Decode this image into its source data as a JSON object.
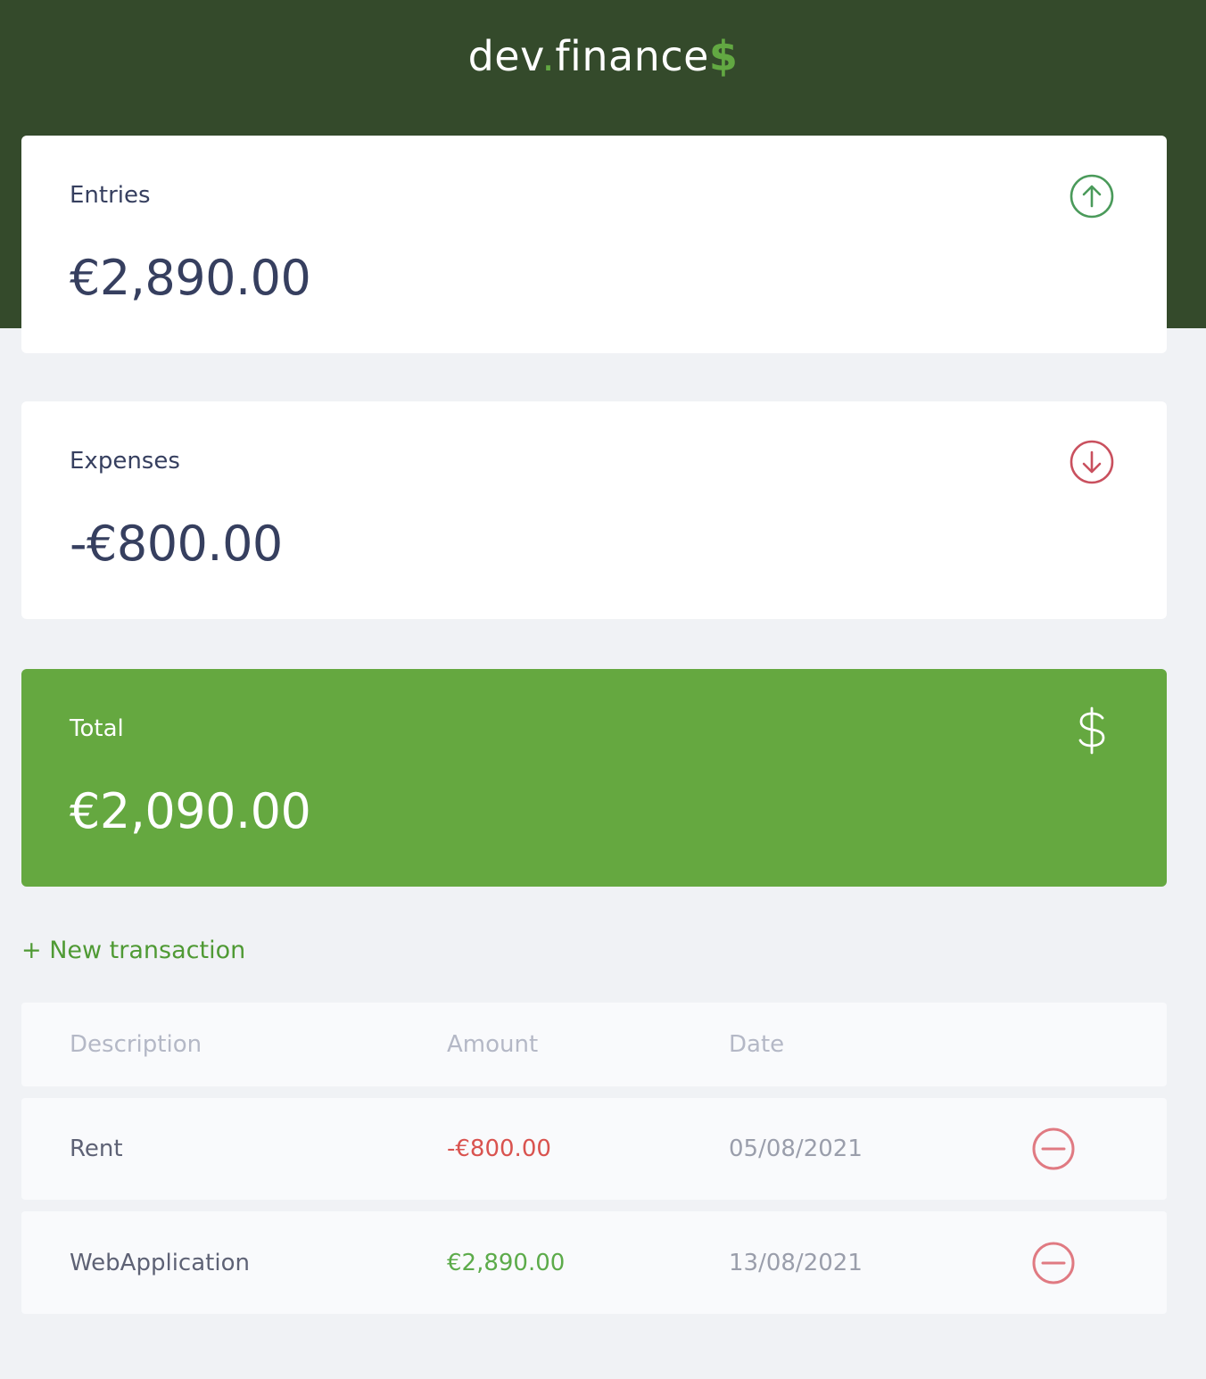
{
  "app": {
    "logo_main": "dev",
    "logo_dot": ".",
    "logo_rest": "finance",
    "logo_symbol": "$"
  },
  "cards": {
    "entries": {
      "title": "Entries",
      "value": "€2,890.00",
      "icon": "arrow-up-circle-icon"
    },
    "expenses": {
      "title": "Expenses",
      "value": "-€800.00",
      "icon": "arrow-down-circle-icon"
    },
    "total": {
      "title": "Total",
      "value": "€2,090.00",
      "icon": "dollar-sign-icon"
    }
  },
  "actions": {
    "new_transaction": "+ New transaction"
  },
  "table": {
    "headers": [
      "Description",
      "Amount",
      "Date"
    ],
    "rows": [
      {
        "description": "Rent",
        "amount": "-€800.00",
        "date": "05/08/2021",
        "type": "expense"
      },
      {
        "description": "WebApplication",
        "amount": "€2,890.00",
        "date": "13/08/2021",
        "type": "income"
      }
    ]
  },
  "colors": {
    "header_bg": "#344a2b",
    "accent_green": "#65a840",
    "income": "#5cab4a",
    "expense": "#d9534f",
    "background": "#f0f2f5"
  }
}
